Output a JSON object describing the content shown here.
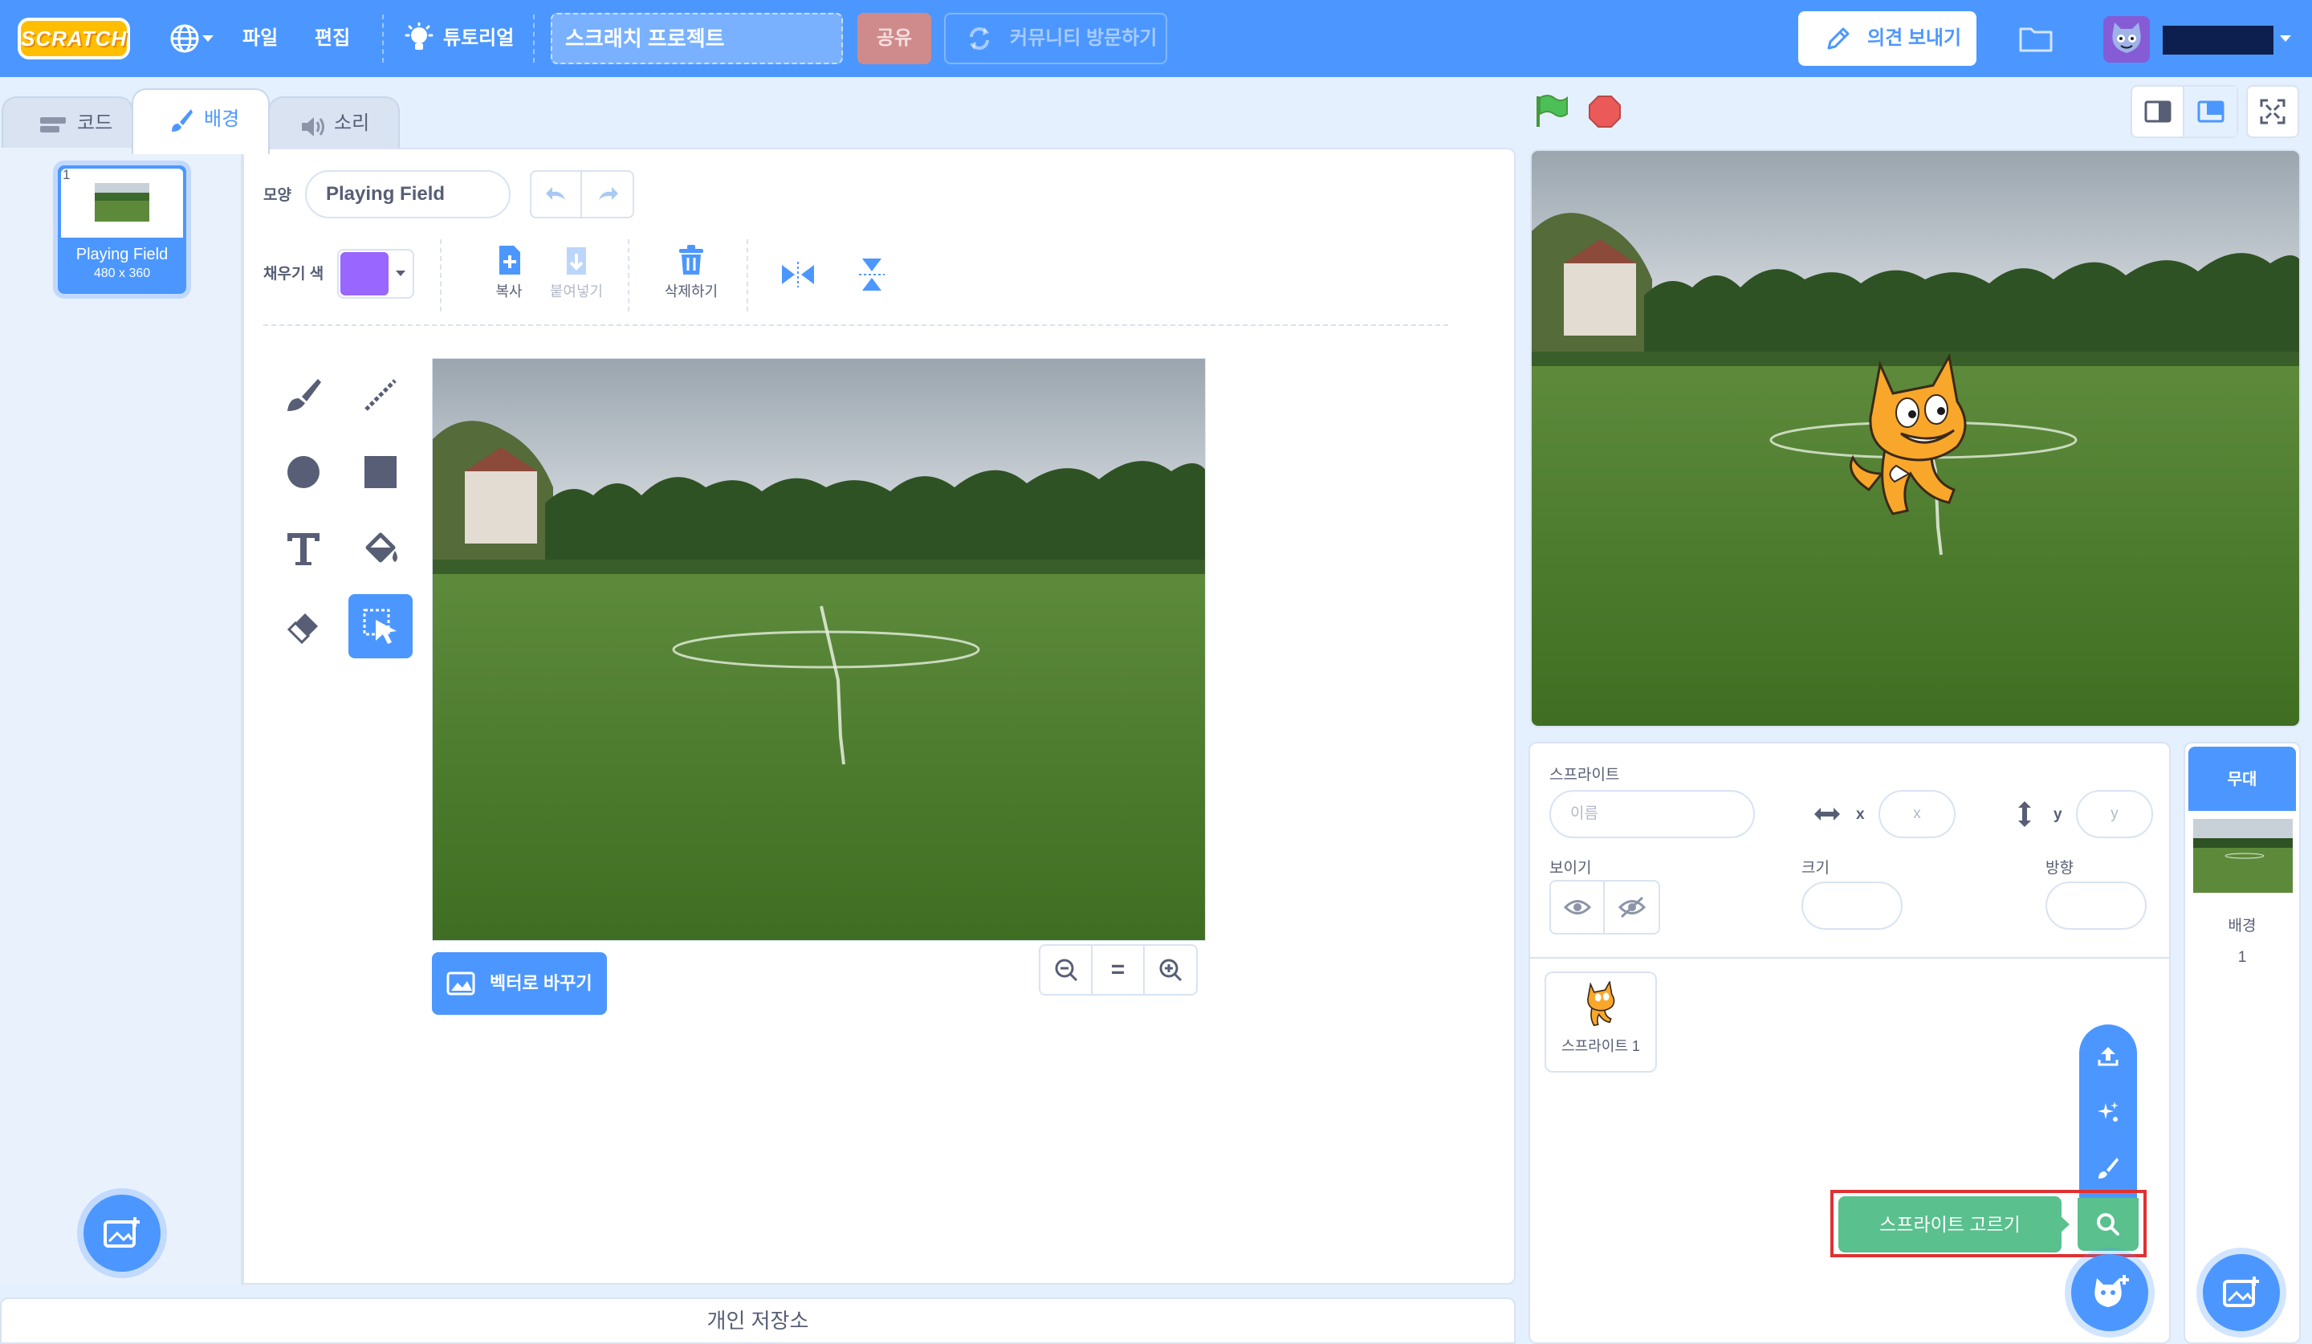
{
  "menubar": {
    "logo": "SCRATCH",
    "file": "파일",
    "edit": "편집",
    "tutorials": "튜토리얼",
    "project_title": "스크래치 프로젝트",
    "share": "공유",
    "community": "커뮤니티 방문하기",
    "feedback": "의견 보내기"
  },
  "tabs": [
    {
      "label": "코드"
    },
    {
      "label": "배경"
    },
    {
      "label": "소리"
    }
  ],
  "costumes": [
    {
      "index": "1",
      "name": "Playing Field",
      "size": "480 x 360"
    }
  ],
  "paint_editor": {
    "costume_label": "모양",
    "costume_name": "Playing Field",
    "fill_label": "채우기 색",
    "fill_color": "#9966ff",
    "copy": "복사",
    "paste": "붙여넣기",
    "delete": "삭제하기",
    "convert_vector": "벡터로 바꾸기",
    "zoom_reset": "="
  },
  "bottom_bar": "개인 저장소",
  "sprite_info": {
    "sprite_label": "스프라이트",
    "name_placeholder": "이름",
    "x_label": "x",
    "x_placeholder": "x",
    "y_label": "y",
    "y_placeholder": "y",
    "show_label": "보이기",
    "size_label": "크기",
    "direction_label": "방향"
  },
  "sprites": [
    {
      "name": "스프라이트 1"
    }
  ],
  "sprite_menu": {
    "tooltip": "스프라이트 고르기"
  },
  "stage_pane": {
    "title": "무대",
    "backdrops_label": "배경",
    "backdrop_count": "1"
  },
  "colors": {
    "brand": "#4c97ff",
    "sprite_tooltip": "#59c08e",
    "highlight_box": "#e03131"
  }
}
